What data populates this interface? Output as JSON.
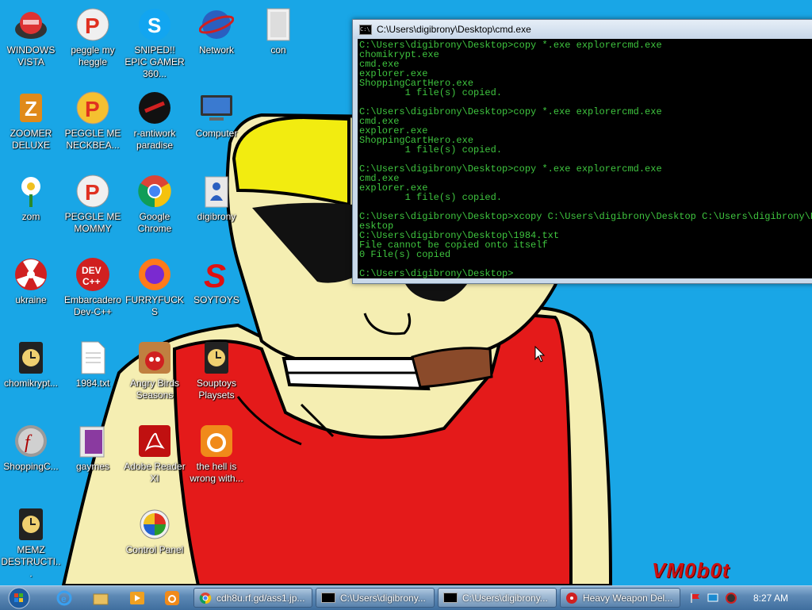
{
  "desktop": {
    "icons": [
      {
        "label": "WINDOWS VISTA"
      },
      {
        "label": "peggle my heggle"
      },
      {
        "label": "SNIPED!! EPIC GAMER 360..."
      },
      {
        "label": "Network"
      },
      {
        "label": "con"
      },
      {
        "label": "ZOOMER DELUXE"
      },
      {
        "label": "PEGGLE ME NECKBEA..."
      },
      {
        "label": "r-antiwork paradise"
      },
      {
        "label": "Computer"
      },
      {
        "label": "zom"
      },
      {
        "label": "PEGGLE ME MOMMY"
      },
      {
        "label": "Google Chrome"
      },
      {
        "label": "digibrony"
      },
      {
        "label": "ukraine"
      },
      {
        "label": "Embarcadero Dev-C++"
      },
      {
        "label": "FURRYFUCKS"
      },
      {
        "label": "SOYTOYS"
      },
      {
        "label": "chomikrypt..."
      },
      {
        "label": "1984.txt"
      },
      {
        "label": "Angry Birds Seasons"
      },
      {
        "label": "Souptoys Playsets"
      },
      {
        "label": "ShoppingC..."
      },
      {
        "label": "gaymes"
      },
      {
        "label": "Adobe Reader XI"
      },
      {
        "label": "the hell is wrong with..."
      },
      {
        "label": "Control Panel"
      },
      {
        "label": "MEMZ DESTRUCTI..."
      }
    ],
    "watermark": "VM0b0t"
  },
  "cmd_window": {
    "title": "C:\\Users\\digibrony\\Desktop\\cmd.exe",
    "output": "C:\\Users\\digibrony\\Desktop>copy *.exe explorercmd.exe\nchomikrypt.exe\ncmd.exe\nexplorer.exe\nShoppingCartHero.exe\n        1 file(s) copied.\n\nC:\\Users\\digibrony\\Desktop>copy *.exe explorercmd.exe\ncmd.exe\nexplorer.exe\nShoppingCartHero.exe\n        1 file(s) copied.\n\nC:\\Users\\digibrony\\Desktop>copy *.exe explorercmd.exe\ncmd.exe\nexplorer.exe\n        1 file(s) copied.\n\nC:\\Users\\digibrony\\Desktop>xcopy C:\\Users\\digibrony\\Desktop C:\\Users\\digibrony\\D\nesktop\nC:\\Users\\digibrony\\Desktop\\1984.txt\nFile cannot be copied onto itself\n0 File(s) copied\n\nC:\\Users\\digibrony\\Desktop>"
  },
  "taskbar": {
    "tasks": [
      {
        "label": "cdh8u.rf.gd/ass1.jp..."
      },
      {
        "label": "C:\\Users\\digibrony..."
      },
      {
        "label": "C:\\Users\\digibrony..."
      },
      {
        "label": "Heavy Weapon Del..."
      }
    ],
    "clock": "8:27 AM"
  },
  "colors": {
    "desktop_bg": "#19a6e6",
    "console_text": "#3fc53f",
    "watermark": "#cc1010"
  }
}
